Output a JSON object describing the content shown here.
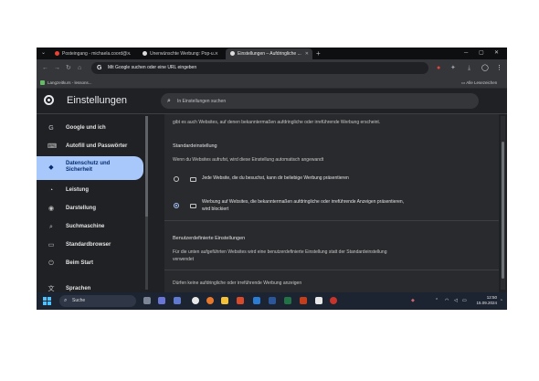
{
  "browser": {
    "tabs": [
      {
        "title": "Posteingang - michaela.coord@...",
        "favicon_color": "#ea4335"
      },
      {
        "title": "Unerwünschte Werbung: Pop-u...",
        "favicon_color": "#dddddd"
      },
      {
        "title": "Einstellungen – Aufdringliche ...",
        "favicon_color": "#dddddd"
      }
    ],
    "new_tab": "+",
    "omnibox_text": "Mit Google suchen oder eine URL eingeben",
    "bookmarks": [
      {
        "label": "Langzeitkurs - lessons..."
      }
    ],
    "all_bookmarks": "Alle Lesezeichen"
  },
  "settings": {
    "title": "Einstellungen",
    "search_placeholder": "In Einstellungen suchen",
    "nav": [
      {
        "label": "Google und ich",
        "icon": "G"
      },
      {
        "label": "Autofill und Passwörter",
        "icon": "⌨"
      },
      {
        "label": "Datenschutz und",
        "label2": "Sicherheit",
        "icon": "🛡"
      },
      {
        "label": "Leistung",
        "icon": "◔"
      },
      {
        "label": "Darstellung",
        "icon": "◉"
      },
      {
        "label": "Suchmaschine",
        "icon": "⌕"
      },
      {
        "label": "Standardbrowser",
        "icon": "▭"
      },
      {
        "label": "Beim Start",
        "icon": "⏻"
      },
      {
        "label": "Sprachen",
        "icon": "文"
      }
    ],
    "active_nav_index": 2
  },
  "content": {
    "intro": "gibt es auch Websites, auf denen bekanntermaßen aufdringliche oder irreführende Werbung erscheint.",
    "default_heading": "Standardeinstellung",
    "default_desc": "Wenn du Websites aufrufst, wird diese Einstellung automatisch angewandt",
    "options": [
      {
        "line1": "Jede Website, die du besuchst, kann dir beliebige Werbung präsentieren",
        "line2": "",
        "checked": false
      },
      {
        "line1": "Werbung auf Websites, die bekanntermaßen aufdringliche oder irreführende Anzeigen präsentieren,",
        "line2": "wird blockiert",
        "checked": true
      }
    ],
    "custom_heading": "Benutzerdefinierte Einstellungen",
    "custom_desc1": "Für die unten aufgeführten Websites wird eine benutzerdefinierte Einstellung statt der Standardeinstellung",
    "custom_desc2": "verwendet",
    "block_heading": "Dürfen keine aufdringliche oder irreführende Werbung anzeigen"
  },
  "taskbar": {
    "search_label": "Suche",
    "time": "12:50",
    "date": "15.09.2024"
  }
}
